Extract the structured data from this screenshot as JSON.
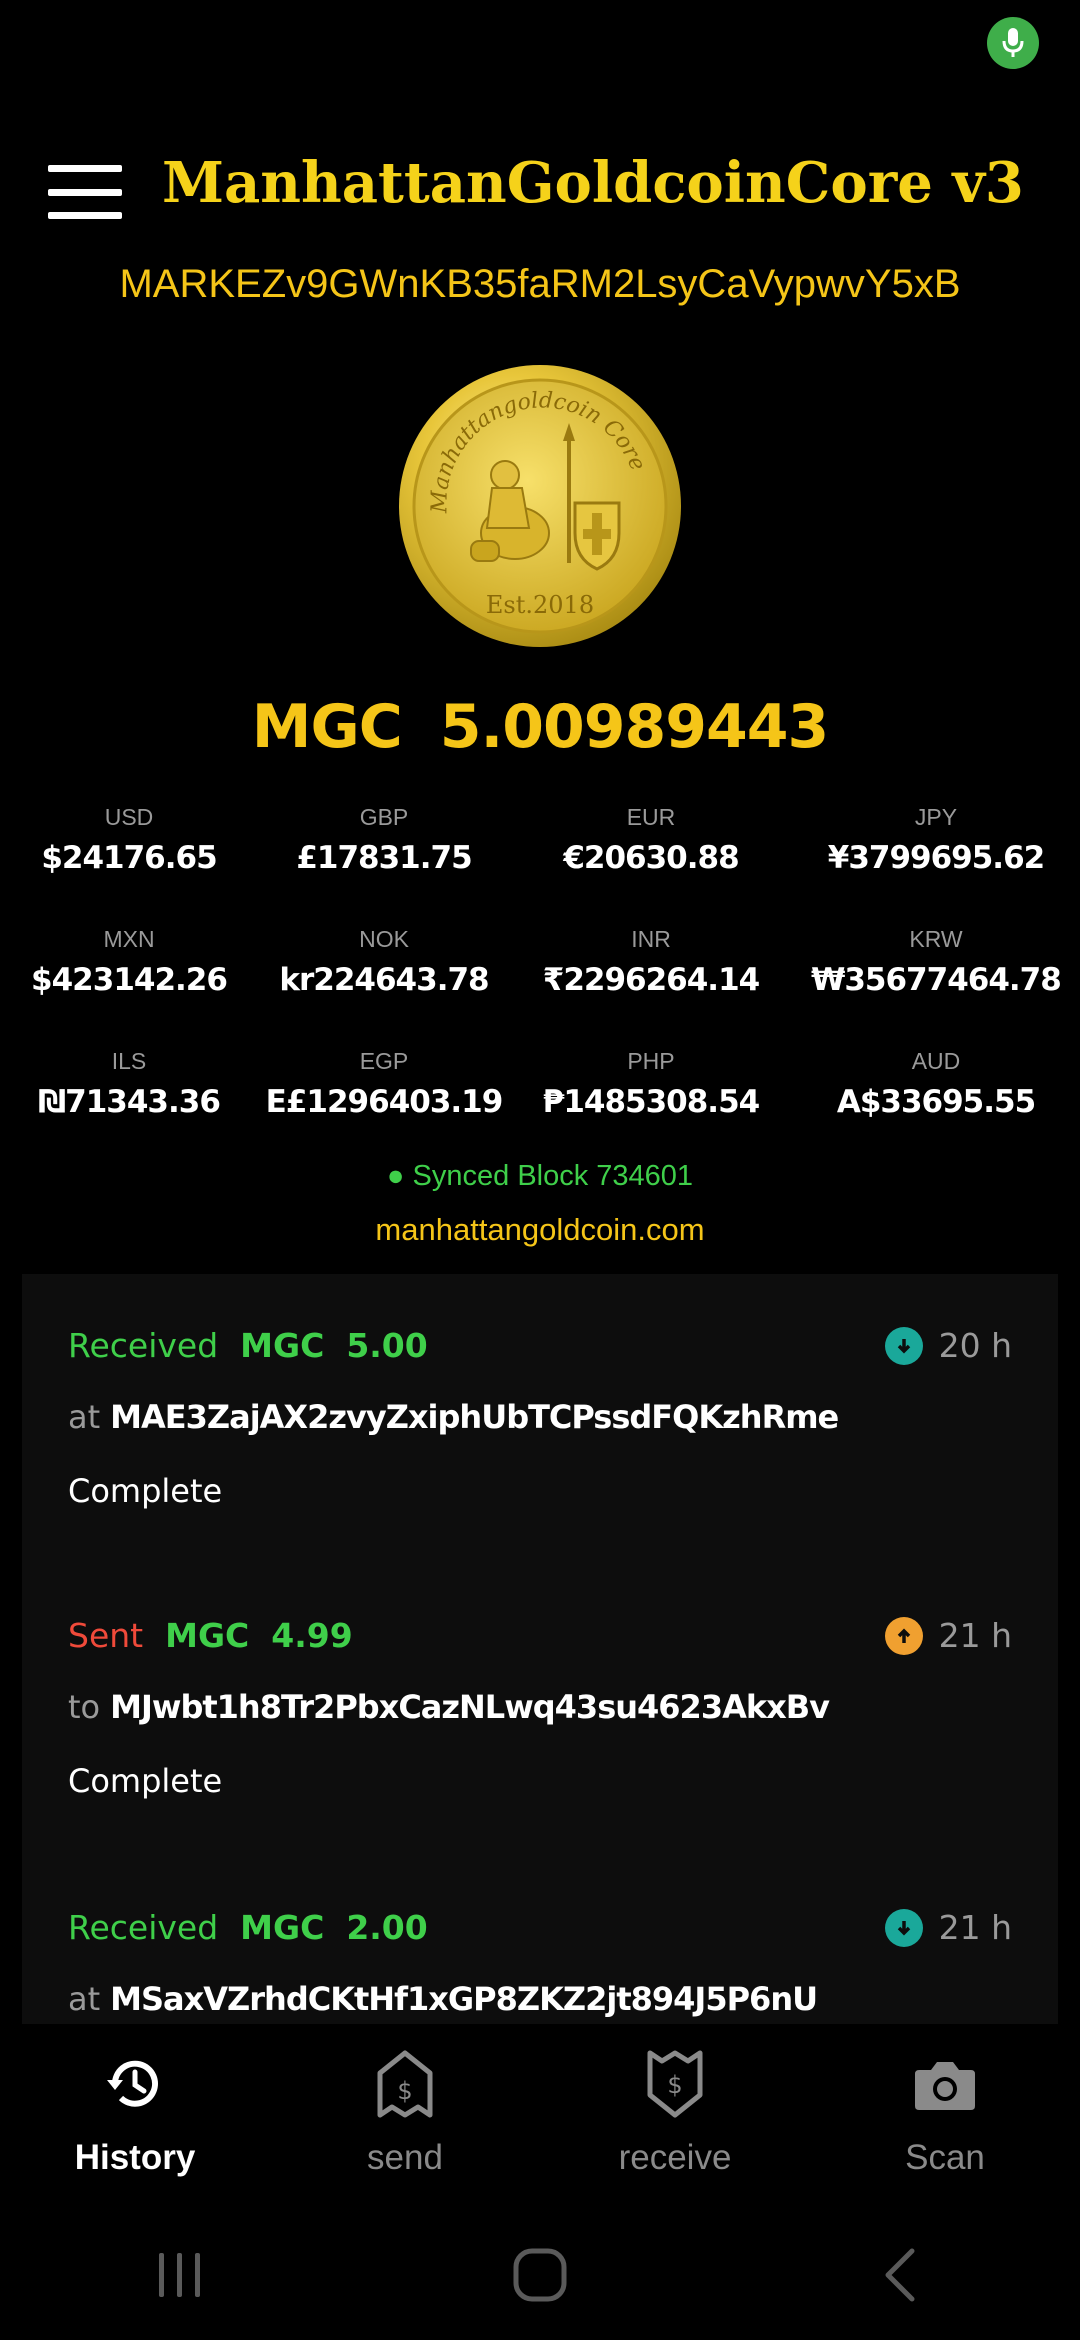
{
  "header": {
    "title": "ManhattanGoldcoinCore v3",
    "address": "MARKEZv9GWnKB35faRM2LsyCaVypwvY5xB"
  },
  "coin": {
    "rim_text": "Manhattangoldcoin Core",
    "est_text": "Est.2018"
  },
  "balance": {
    "symbol": "MGC",
    "amount": "5.00989443"
  },
  "fiat": [
    {
      "code": "USD",
      "value": "$24176.65"
    },
    {
      "code": "GBP",
      "value": "£17831.75"
    },
    {
      "code": "EUR",
      "value": "€20630.88"
    },
    {
      "code": "JPY",
      "value": "¥3799695.62"
    },
    {
      "code": "MXN",
      "value": "$423142.26"
    },
    {
      "code": "NOK",
      "value": "kr224643.78"
    },
    {
      "code": "INR",
      "value": "₹2296264.14"
    },
    {
      "code": "KRW",
      "value": "₩35677464.78"
    },
    {
      "code": "ILS",
      "value": "₪71343.36"
    },
    {
      "code": "EGP",
      "value": "E£1296403.19"
    },
    {
      "code": "PHP",
      "value": "₱1485308.54"
    },
    {
      "code": "AUD",
      "value": "A$33695.55"
    }
  ],
  "sync": {
    "dot": "●",
    "status": "Synced",
    "block_label": "Block 734601"
  },
  "site": "manhattangoldcoin.com",
  "transactions": [
    {
      "type": "Received",
      "symbol": "MGC",
      "amount": "5.00",
      "time": "20 h",
      "preposition": "at",
      "address": "MAE3ZajAX2zvyZxiphUbTCPssdFQKzhRme",
      "status": "Complete",
      "direction": "incoming",
      "icon": "arrow-down-circle-icon",
      "icon_color": "#1aa89a"
    },
    {
      "type": "Sent",
      "symbol": "MGC",
      "amount": "4.99",
      "time": "21 h",
      "preposition": "to",
      "address": "MJwbt1h8Tr2PbxCazNLwq43su4623AkxBv",
      "status": "Complete",
      "direction": "outgoing",
      "icon": "arrow-up-circle-icon",
      "icon_color": "#f0a030"
    },
    {
      "type": "Received",
      "symbol": "MGC",
      "amount": "2.00",
      "time": "21 h",
      "preposition": "at",
      "address": "MSaxVZrhdCKtHf1xGP8ZKZ2jt894J5P6nU",
      "status": "",
      "direction": "incoming",
      "icon": "arrow-down-circle-icon",
      "icon_color": "#1aa89a"
    }
  ],
  "nav": {
    "history": {
      "label": "History",
      "icon": "history-icon"
    },
    "send": {
      "label": "send",
      "icon": "send-money-icon"
    },
    "receive": {
      "label": "receive",
      "icon": "receive-money-icon"
    },
    "scan": {
      "label": "Scan",
      "icon": "camera-icon"
    }
  },
  "colors": {
    "accent_gold": "#f5c518",
    "received_green": "#3fcf4a",
    "sent_red": "#f04a3a",
    "mic_green": "#3fae4a"
  }
}
